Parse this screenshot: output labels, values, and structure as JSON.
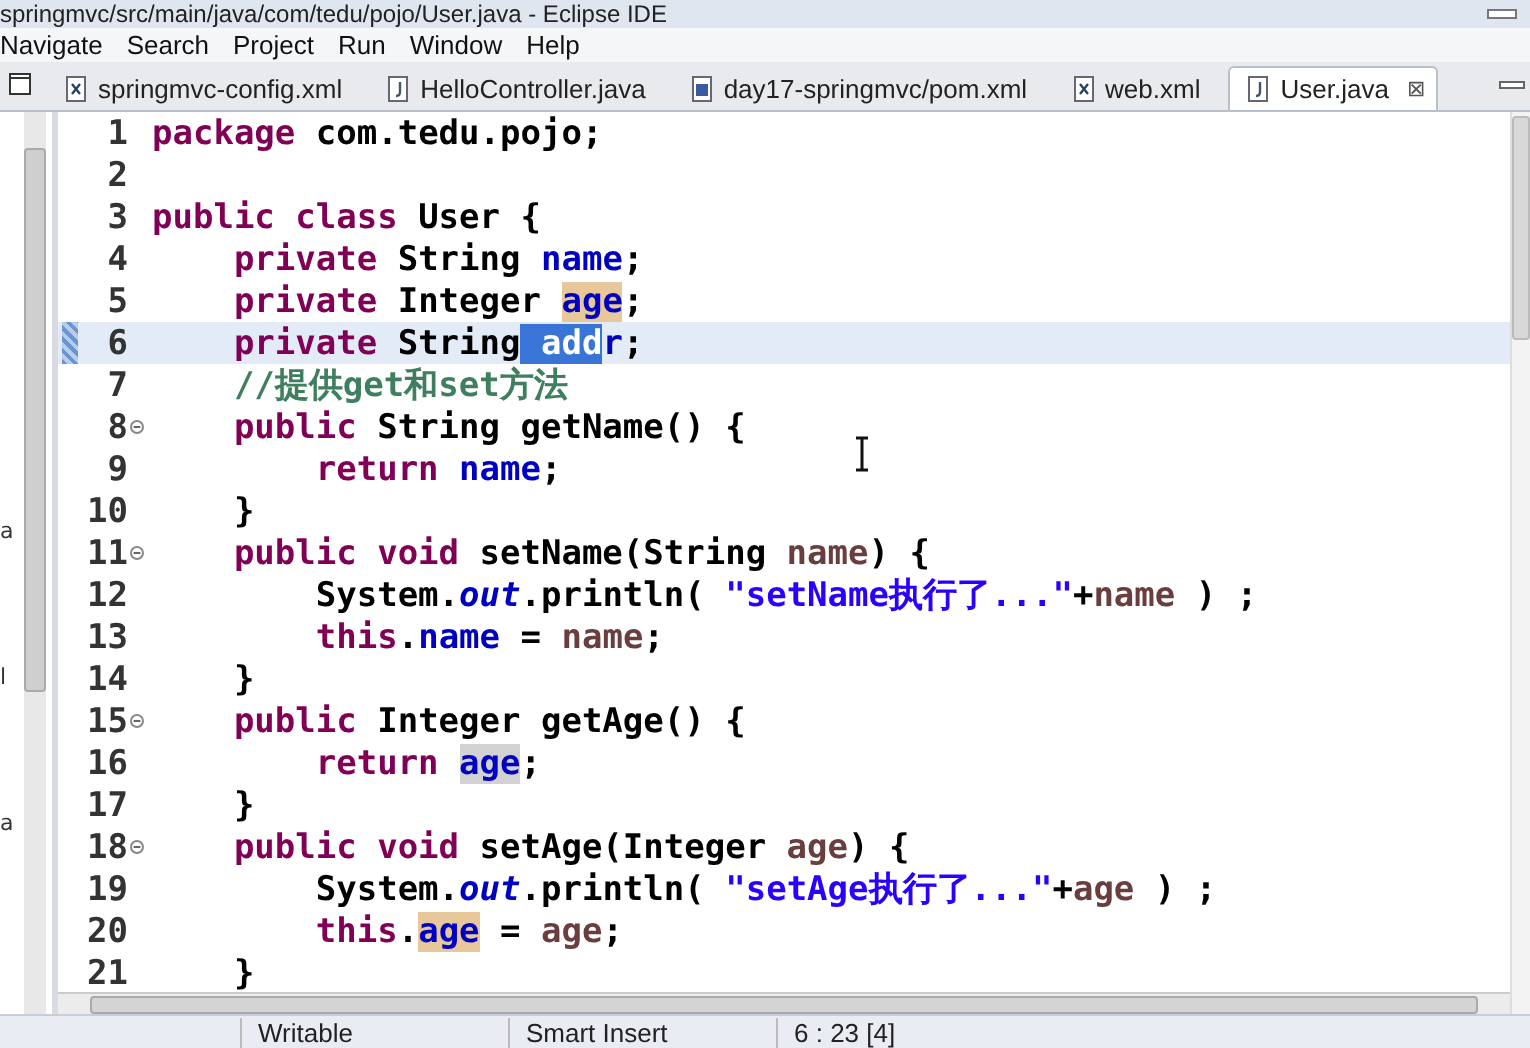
{
  "window": {
    "title": "springmvc/src/main/java/com/tedu/pojo/User.java - Eclipse IDE"
  },
  "menu": [
    "Navigate",
    "Search",
    "Project",
    "Run",
    "Window",
    "Help"
  ],
  "tabs": [
    {
      "label": "springmvc-config.xml",
      "kind": "xml",
      "selected": false
    },
    {
      "label": "HelloController.java",
      "kind": "java",
      "selected": false
    },
    {
      "label": "day17-springmvc/pom.xml",
      "kind": "maven",
      "selected": false
    },
    {
      "label": "web.xml",
      "kind": "xml",
      "selected": false
    },
    {
      "label": "User.java",
      "kind": "java",
      "selected": true,
      "close": "⊠"
    }
  ],
  "left_panel": {
    "fragments": [
      "a",
      "l",
      "a"
    ]
  },
  "editor": {
    "lines": [
      {
        "num": "1",
        "fold": false,
        "current": false,
        "tokens": [
          {
            "t": "package",
            "kind": "kw"
          },
          {
            "t": " com.tedu.pojo;",
            "kind": "plain"
          }
        ]
      },
      {
        "num": "2",
        "fold": false,
        "current": false
      },
      {
        "num": "3",
        "fold": false,
        "current": false,
        "tokens": [
          {
            "t": "public class",
            "kind": "kw"
          },
          {
            "t": " User {",
            "kind": "plain"
          }
        ]
      },
      {
        "num": "4",
        "fold": false,
        "current": false,
        "tokens": [
          {
            "t": "    private",
            "kind": "kw"
          },
          {
            "t": " String ",
            "kind": "plain"
          },
          {
            "t": "name",
            "kind": "field"
          },
          {
            "t": ";",
            "kind": "plain"
          }
        ]
      },
      {
        "num": "5",
        "fold": false,
        "current": false,
        "tokens": [
          {
            "t": "    private",
            "kind": "kw"
          },
          {
            "t": " Integer ",
            "kind": "plain"
          },
          {
            "t": "age",
            "kind": "field",
            "write_occurrence": true
          },
          {
            "t": ";",
            "kind": "plain"
          }
        ]
      },
      {
        "num": "6",
        "fold": false,
        "current": true,
        "tokens": [
          {
            "t": "    private",
            "kind": "kw"
          },
          {
            "t": " String",
            "kind": "plain"
          },
          {
            "t": " add",
            "kind": "field",
            "selected": true
          },
          {
            "t": "r",
            "kind": "field"
          },
          {
            "t": ";",
            "kind": "plain"
          }
        ]
      },
      {
        "num": "7",
        "fold": false,
        "current": false,
        "tokens": [
          {
            "t": "    //提供get和set方法",
            "kind": "comment"
          }
        ]
      },
      {
        "num": "8",
        "fold": true,
        "current": false,
        "tokens": [
          {
            "t": "    public",
            "kind": "kw"
          },
          {
            "t": " String getName() {",
            "kind": "plain"
          }
        ]
      },
      {
        "num": "9",
        "fold": false,
        "current": false,
        "tokens": [
          {
            "t": "        return",
            "kind": "kw"
          },
          {
            "t": " name",
            "kind": "field"
          },
          {
            "t": ";",
            "kind": "plain"
          }
        ]
      },
      {
        "num": "10",
        "fold": false,
        "current": false,
        "tokens": [
          {
            "t": "    }",
            "kind": "plain"
          }
        ]
      },
      {
        "num": "11",
        "fold": true,
        "current": false,
        "tokens": [
          {
            "t": "    public void",
            "kind": "kw"
          },
          {
            "t": " setName(String ",
            "kind": "plain"
          },
          {
            "t": "name",
            "kind": "local"
          },
          {
            "t": ") {",
            "kind": "plain"
          }
        ]
      },
      {
        "num": "12",
        "fold": false,
        "current": false,
        "tokens": [
          {
            "t": "        System.",
            "kind": "plain"
          },
          {
            "t": "out",
            "kind": "static"
          },
          {
            "t": ".println( ",
            "kind": "plain"
          },
          {
            "t": "\"setName执行了...\"",
            "kind": "string"
          },
          {
            "t": "+",
            "kind": "plain"
          },
          {
            "t": "name",
            "kind": "local"
          },
          {
            "t": " ) ;",
            "kind": "plain"
          }
        ]
      },
      {
        "num": "13",
        "fold": false,
        "current": false,
        "tokens": [
          {
            "t": "        this",
            "kind": "kw"
          },
          {
            "t": ".",
            "kind": "plain"
          },
          {
            "t": "name",
            "kind": "field"
          },
          {
            "t": " = ",
            "kind": "plain"
          },
          {
            "t": "name",
            "kind": "local"
          },
          {
            "t": ";",
            "kind": "plain"
          }
        ]
      },
      {
        "num": "14",
        "fold": false,
        "current": false,
        "tokens": [
          {
            "t": "    }",
            "kind": "plain"
          }
        ]
      },
      {
        "num": "15",
        "fold": true,
        "current": false,
        "tokens": [
          {
            "t": "    public",
            "kind": "kw"
          },
          {
            "t": " Integer getAge() {",
            "kind": "plain"
          }
        ]
      },
      {
        "num": "16",
        "fold": false,
        "current": false,
        "tokens": [
          {
            "t": "        return ",
            "kind": "kw"
          },
          {
            "t": "age",
            "kind": "field",
            "read_occurrence": true
          },
          {
            "t": ";",
            "kind": "plain"
          }
        ]
      },
      {
        "num": "17",
        "fold": false,
        "current": false,
        "tokens": [
          {
            "t": "    }",
            "kind": "plain"
          }
        ]
      },
      {
        "num": "18",
        "fold": true,
        "current": false,
        "tokens": [
          {
            "t": "    public void",
            "kind": "kw"
          },
          {
            "t": " setAge(Integer ",
            "kind": "plain"
          },
          {
            "t": "age",
            "kind": "local"
          },
          {
            "t": ") {",
            "kind": "plain"
          }
        ]
      },
      {
        "num": "19",
        "fold": false,
        "current": false,
        "tokens": [
          {
            "t": "        System.",
            "kind": "plain"
          },
          {
            "t": "out",
            "kind": "static"
          },
          {
            "t": ".println( ",
            "kind": "plain"
          },
          {
            "t": "\"setAge执行了...\"",
            "kind": "string"
          },
          {
            "t": "+",
            "kind": "plain"
          },
          {
            "t": "age",
            "kind": "local"
          },
          {
            "t": " ) ;",
            "kind": "plain"
          }
        ]
      },
      {
        "num": "20",
        "fold": false,
        "current": false,
        "tokens": [
          {
            "t": "        this",
            "kind": "kw"
          },
          {
            "t": ".",
            "kind": "plain"
          },
          {
            "t": "age",
            "kind": "field",
            "write_occurrence": true
          },
          {
            "t": " = ",
            "kind": "plain"
          },
          {
            "t": "age",
            "kind": "local"
          },
          {
            "t": ";",
            "kind": "plain"
          }
        ]
      },
      {
        "num": "21",
        "fold": false,
        "current": false,
        "tokens": [
          {
            "t": "    }",
            "kind": "plain"
          }
        ]
      }
    ]
  },
  "status_bar": [
    "Writable",
    "Smart Insert",
    "6 : 23 [4]"
  ]
}
